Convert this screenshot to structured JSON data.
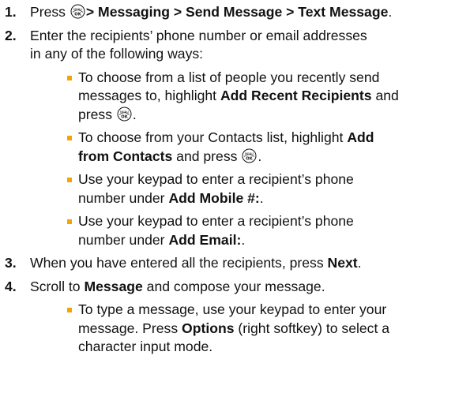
{
  "steps": [
    {
      "number": "1.",
      "pre": "Press ",
      "path": "> Messaging > Send Message > Text Message",
      "post": "."
    },
    {
      "number": "2.",
      "line1": "Enter the recipients’ phone number or email addresses",
      "line2": "in any of the following ways:",
      "bullets": [
        {
          "line1": "To choose from a list of people you recently send",
          "line2_pre": "messages to, highlight ",
          "line2_bold": "Add Recent Recipients",
          "line2_post": " and",
          "line3_pre": "press ",
          "line3_post": "."
        },
        {
          "line1_pre": "To choose from your Contacts list, highlight ",
          "line1_bold": "Add",
          "line2_bold": "from Contacts",
          "line2_pre": " and press ",
          "line2_post": "."
        },
        {
          "line1": "Use your keypad to enter a recipient’s phone",
          "line2_pre": "number under ",
          "line2_bold": "Add Mobile #:",
          "line2_post": "."
        },
        {
          "line1": "Use your keypad to enter a recipient’s phone",
          "line2_pre": "number under ",
          "line2_bold": "Add Email:",
          "line2_post": "."
        }
      ]
    },
    {
      "number": "3.",
      "pre": "When you have entered all the recipients, press ",
      "bold": "Next",
      "post": "."
    },
    {
      "number": "4.",
      "pre": "Scroll to ",
      "bold": "Message",
      "post": " and compose your message.",
      "bullets": [
        {
          "line1": "To type a message, use your keypad to enter your",
          "line2_pre": "message. Press ",
          "line2_bold": "Options",
          "line2_post": " (right softkey) to select a",
          "line3": "character input mode."
        }
      ]
    }
  ],
  "key_icon": {
    "name": "menu-ok-key-icon",
    "top_text": "MENU",
    "bottom_text": "OK"
  },
  "colors": {
    "bullet": "#f5a500",
    "text": "#111111"
  }
}
